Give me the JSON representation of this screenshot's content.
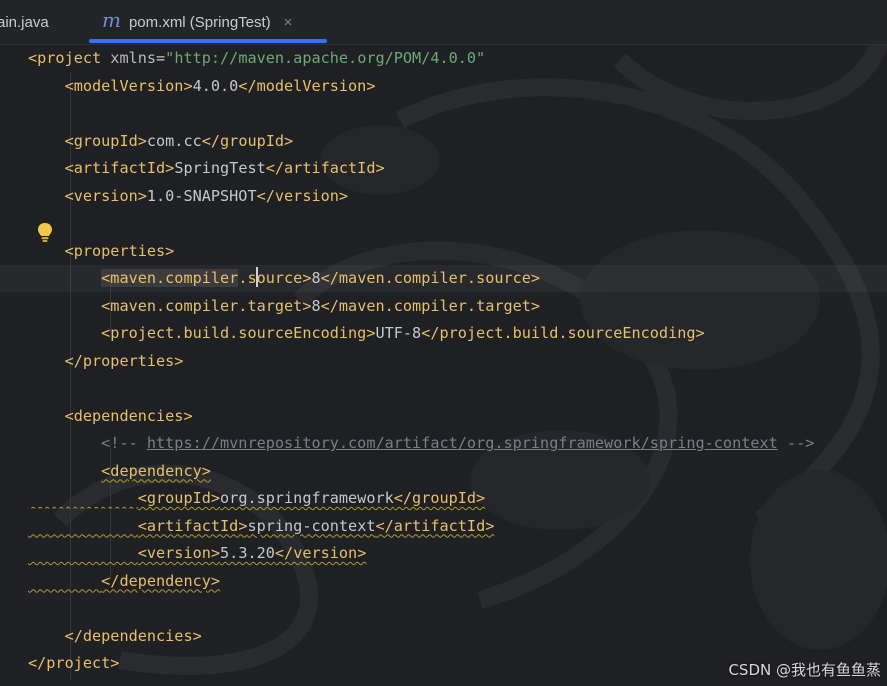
{
  "tabs": [
    {
      "label": "ain.java",
      "active": false
    },
    {
      "icon_glyph": "m",
      "label": "pom.xml (SpringTest)",
      "close_glyph": "×",
      "active": true
    }
  ],
  "editor": {
    "language": "xml",
    "lines": [
      [
        [
          "tag",
          "<project "
        ],
        [
          "attr",
          "xmlns"
        ],
        [
          "txt",
          "="
        ],
        [
          "aval",
          "\"http://maven.apache.org/POM/4.0.0\""
        ]
      ],
      [
        [
          "txt",
          "    "
        ],
        [
          "tag",
          "<modelVersion>"
        ],
        [
          "txt",
          "4.0.0"
        ],
        [
          "tag",
          "</modelVersion>"
        ]
      ],
      [],
      [
        [
          "txt",
          "    "
        ],
        [
          "tag",
          "<groupId>"
        ],
        [
          "txt",
          "com.cc"
        ],
        [
          "tag",
          "</groupId>"
        ]
      ],
      [
        [
          "txt",
          "    "
        ],
        [
          "tag",
          "<artifactId>"
        ],
        [
          "txt",
          "SpringTest"
        ],
        [
          "tag",
          "</artifactId>"
        ]
      ],
      [
        [
          "txt",
          "    "
        ],
        [
          "tag",
          "<version>"
        ],
        [
          "txt",
          "1.0-SNAPSHOT"
        ],
        [
          "tag",
          "</version>"
        ]
      ],
      [],
      [
        [
          "txt",
          "    "
        ],
        [
          "tag",
          "<properties>"
        ]
      ],
      [
        [
          "txt",
          "        "
        ],
        [
          "tag sel-box",
          "<maven.compiler"
        ],
        [
          "tag",
          ".source>"
        ],
        [
          "txt",
          "8"
        ],
        [
          "tag",
          "</maven.compiler.source>"
        ]
      ],
      [
        [
          "txt",
          "        "
        ],
        [
          "tag",
          "<maven.compiler.target>"
        ],
        [
          "txt",
          "8"
        ],
        [
          "tag",
          "</maven.compiler.target>"
        ]
      ],
      [
        [
          "txt",
          "        "
        ],
        [
          "tag",
          "<project.build.sourceEncoding>"
        ],
        [
          "txt",
          "UTF-8"
        ],
        [
          "tag",
          "</project.build.sourceEncoding>"
        ]
      ],
      [
        [
          "txt",
          "    "
        ],
        [
          "tag",
          "</properties>"
        ]
      ],
      [],
      [
        [
          "txt",
          "    "
        ],
        [
          "tag",
          "<dependencies>"
        ]
      ],
      [
        [
          "txt",
          "        "
        ],
        [
          "cmt",
          "<!-- "
        ],
        [
          "cmt-link",
          "https://mvnrepository.com/artifact/org.springframework/spring-context"
        ],
        [
          "cmt",
          " -->"
        ]
      ],
      [
        [
          "txt",
          "        "
        ],
        [
          "tag squiggle",
          "<dependency>"
        ]
      ],
      [
        [
          "squiggle",
          "            "
        ],
        [
          "tag squiggle",
          "<groupId>"
        ],
        [
          "txt squiggle",
          "org.springframework"
        ],
        [
          "tag squiggle",
          "</groupId>"
        ]
      ],
      [
        [
          "squiggle",
          "            "
        ],
        [
          "tag squiggle",
          "<artifactId>"
        ],
        [
          "txt squiggle",
          "spring-context"
        ],
        [
          "tag squiggle",
          "</artifactId>"
        ]
      ],
      [
        [
          "squiggle",
          "            "
        ],
        [
          "tag squiggle",
          "<version>"
        ],
        [
          "txt squiggle",
          "5.3.20"
        ],
        [
          "tag squiggle",
          "</version>"
        ]
      ],
      [
        [
          "squiggle",
          "        "
        ],
        [
          "tag squiggle",
          "</dependency>"
        ]
      ],
      [],
      [
        [
          "txt",
          "    "
        ],
        [
          "tag",
          "</dependencies>"
        ]
      ],
      [
        [
          "tag",
          "</project>"
        ]
      ]
    ],
    "current_line_index": 8,
    "intention_icon": "lightbulb-icon"
  },
  "watermark": "CSDN @我也有鱼鱼蒸",
  "colors": {
    "background": "#1f2023",
    "tag": "#e8bf6a",
    "attribute_value": "#6aab73",
    "comment": "#7a7e85",
    "accent": "#3574f0",
    "warning_squiggle": "#b29a2f"
  }
}
